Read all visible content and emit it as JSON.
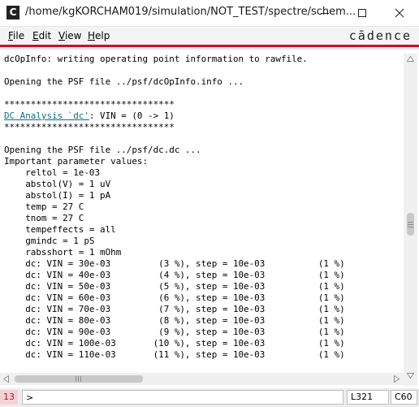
{
  "window": {
    "app_icon": "cadence-c-icon",
    "title": "/home/kgKORCHAM019/simulation/NOT_TEST/spectre/schem..."
  },
  "menu": {
    "file": "File",
    "edit": "Edit",
    "view": "View",
    "help": "Help",
    "logo": "cādence"
  },
  "log": {
    "lines": [
      "dcOpInfo: writing operating point information to rawfile.",
      "",
      "Opening the PSF file ../psf/dcOpInfo.info ...",
      "",
      "********************************",
      "",
      "********************************",
      "",
      "Opening the PSF file ../psf/dc.dc ...",
      "Important parameter values:",
      "    reltol = 1e-03",
      "    abstol(V) = 1 uV",
      "    abstol(I) = 1 pA",
      "    temp = 27 C",
      "    tnom = 27 C",
      "    tempeffects = all",
      "    gmindc = 1 pS",
      "    rabsshort = 1 mOhm",
      "    dc: VIN = 30e-03         (3 %), step = 10e-03          (1 %)",
      "    dc: VIN = 40e-03         (4 %), step = 10e-03          (1 %)",
      "    dc: VIN = 50e-03         (5 %), step = 10e-03          (1 %)",
      "    dc: VIN = 60e-03         (6 %), step = 10e-03          (1 %)",
      "    dc: VIN = 70e-03         (7 %), step = 10e-03          (1 %)",
      "    dc: VIN = 80e-03         (8 %), step = 10e-03          (1 %)",
      "    dc: VIN = 90e-03         (9 %), step = 10e-03          (1 %)",
      "    dc: VIN = 100e-03       (10 %), step = 10e-03          (1 %)",
      "    dc: VIN = 110e-03       (11 %), step = 10e-03          (1 %)"
    ],
    "dc_link": "DC Analysis `dc'",
    "dc_rest": ": VIN = (0 -> 1)"
  },
  "status": {
    "line_number": "13",
    "prompt": ">",
    "line_pos": "L321",
    "col_pos": "C60"
  },
  "colors": {
    "accent_red": "#c8102e",
    "link": "#0a6e8a"
  }
}
